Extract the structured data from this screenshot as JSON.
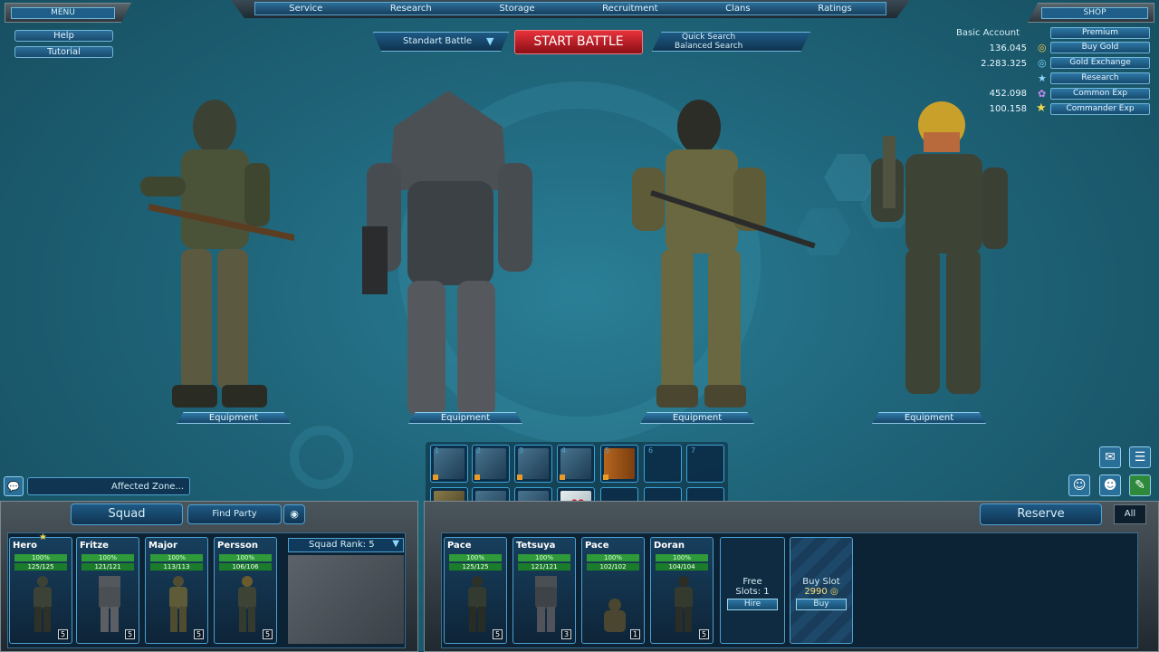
{
  "menu": {
    "title": "MENU",
    "help": "Help",
    "tutorial": "Tutorial"
  },
  "topnav": [
    "Service",
    "Research",
    "Storage",
    "Recruitment",
    "Clans",
    "Ratings"
  ],
  "shop": {
    "title": "SHOP",
    "account": "Basic Account",
    "premium": "Premium"
  },
  "battle": {
    "mode": "Standart Battle",
    "start": "START BATTLE",
    "quick": "Quick Search",
    "balanced": "Balanced Search"
  },
  "resources": [
    {
      "value": "136.045",
      "label": "Buy Gold"
    },
    {
      "value": "2.283.325",
      "label": "Gold Exchange"
    },
    {
      "value": "",
      "label": "Research"
    },
    {
      "value": "452.098",
      "label": "Common Exp"
    },
    {
      "value": "100.158",
      "label": "Commander Exp"
    }
  ],
  "equipment_label": "Equipment",
  "chat": {
    "zone": "Affected Zone..."
  },
  "squad": {
    "title": "Squad",
    "find_party": "Find Party",
    "rank": "Squad Rank: 5",
    "members": [
      {
        "name": "Hero",
        "a": "100%",
        "hp": "125/125",
        "lvl": "5"
      },
      {
        "name": "Fritze",
        "a": "100%",
        "hp": "121/121",
        "lvl": "5"
      },
      {
        "name": "Major",
        "a": "100%",
        "hp": "113/113",
        "lvl": "5"
      },
      {
        "name": "Persson",
        "a": "100%",
        "hp": "106/106",
        "lvl": "5"
      }
    ]
  },
  "reserve": {
    "title": "Reserve",
    "all": "All",
    "members": [
      {
        "name": "Pace",
        "a": "100%",
        "hp": "125/125",
        "lvl": "5"
      },
      {
        "name": "Tetsuya",
        "a": "100%",
        "hp": "121/121",
        "lvl": "3"
      },
      {
        "name": "Pace",
        "a": "100%",
        "hp": "102/102",
        "lvl": "1"
      },
      {
        "name": "Doran",
        "a": "100%",
        "hp": "104/104",
        "lvl": "5"
      }
    ],
    "free": "Free",
    "slots": "Slots: 1",
    "hire": "Hire",
    "buy_slot": "Buy Slot",
    "price": "2990",
    "buy": "Buy"
  },
  "colors": {
    "accent": "#4ea3d3",
    "start": "#c8202a"
  }
}
